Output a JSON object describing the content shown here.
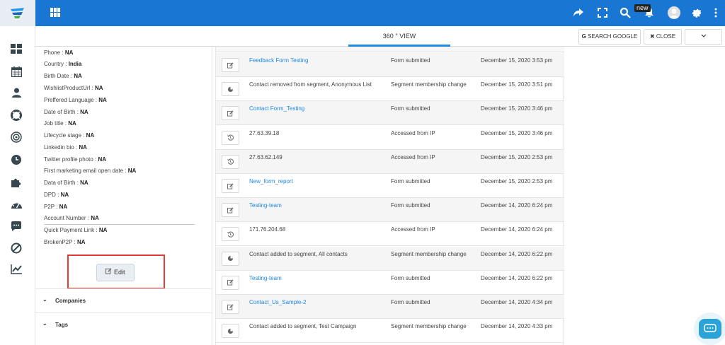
{
  "header": {
    "new_badge": "new"
  },
  "subheader": {
    "view_tab": "360 ° VIEW",
    "search_google": "SEARCH GOOGLE",
    "close": "CLOSE"
  },
  "details": {
    "fields": [
      {
        "label": "Phone : ",
        "value": "NA"
      },
      {
        "label": "Country : ",
        "value": "India"
      },
      {
        "label": "Birth Date : ",
        "value": "NA"
      },
      {
        "label": "WishlistProductUrl : ",
        "value": "NA"
      },
      {
        "label": "Preffered Language : ",
        "value": "NA"
      },
      {
        "label": "Date of Birth : ",
        "value": "NA"
      },
      {
        "label": "Job title : ",
        "value": "NA"
      },
      {
        "label": "Lifecycle stage : ",
        "value": "NA"
      },
      {
        "label": "Linkedin bio : ",
        "value": "NA"
      },
      {
        "label": "Twitter profile photo : ",
        "value": "NA"
      },
      {
        "label": "First marketing email open date : ",
        "value": "NA"
      },
      {
        "label": "Data of Birth : ",
        "value": "NA"
      },
      {
        "label": "DPD : ",
        "value": "NA"
      },
      {
        "label": "P2P : ",
        "value": "NA"
      },
      {
        "label": "Account Number : ",
        "value": "NA"
      },
      {
        "label": "Quick Payment Link : ",
        "value": "NA"
      },
      {
        "label": "BrokenP2P : ",
        "value": "NA"
      }
    ],
    "edit_label": "Edit",
    "companies_label": "Companies",
    "tags_label": "Tags"
  },
  "activity": {
    "rows": [
      {
        "icon": "edit-icon",
        "desc": "Feedback Form Testing",
        "link": true,
        "type": "Form submitted",
        "date": "December 15, 2020 3:53 pm"
      },
      {
        "icon": "segment-icon",
        "desc": "Contact removed from segment, Anonymous List",
        "link": false,
        "type": "Segment membership change",
        "date": "December 15, 2020 3:51 pm"
      },
      {
        "icon": "edit-icon",
        "desc": "Contact Form_Testing",
        "link": true,
        "type": "Form submitted",
        "date": "December 15, 2020 3:46 pm"
      },
      {
        "icon": "history-icon",
        "desc": "27.63.39.18",
        "link": false,
        "type": "Accessed from IP",
        "date": "December 15, 2020 3:46 pm"
      },
      {
        "icon": "history-icon",
        "desc": "27.63.62.149",
        "link": false,
        "type": "Accessed from IP",
        "date": "December 15, 2020 2:53 pm"
      },
      {
        "icon": "edit-icon",
        "desc": "New_form_report",
        "link": true,
        "type": "Form submitted",
        "date": "December 15, 2020 2:53 pm"
      },
      {
        "icon": "edit-icon",
        "desc": "Testing-team",
        "link": true,
        "type": "Form submitted",
        "date": "December 14, 2020 6:24 pm"
      },
      {
        "icon": "history-icon",
        "desc": "171.76.204.68",
        "link": false,
        "type": "Accessed from IP",
        "date": "December 14, 2020 6:24 pm"
      },
      {
        "icon": "segment-icon",
        "desc": "Contact added to segment, All contacts",
        "link": false,
        "type": "Segment membership change",
        "date": "December 14, 2020 6:22 pm"
      },
      {
        "icon": "edit-icon",
        "desc": "Testing-team",
        "link": true,
        "type": "Form submitted",
        "date": "December 14, 2020 6:22 pm"
      },
      {
        "icon": "edit-icon",
        "desc": "Contact_Us_Sample-2",
        "link": true,
        "type": "Form submitted",
        "date": "December 14, 2020 4:34 pm"
      },
      {
        "icon": "segment-icon",
        "desc": "Contact added to segment, Test Campaign",
        "link": false,
        "type": "Segment membership change",
        "date": "December 14, 2020 4:33 pm"
      }
    ]
  },
  "colors": {
    "topbar": "#1976d2",
    "link": "#1e88e5",
    "highlight": "#e53935"
  }
}
